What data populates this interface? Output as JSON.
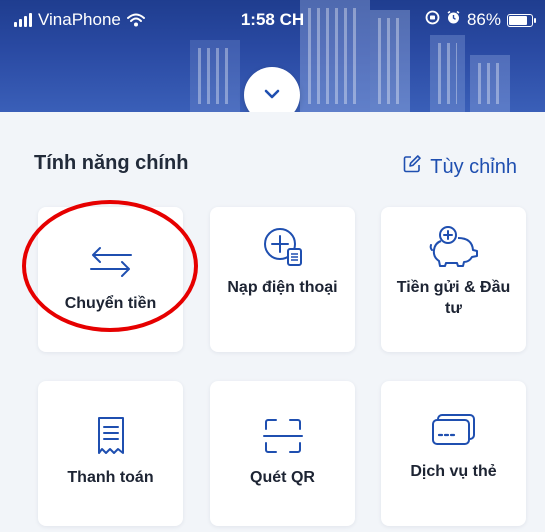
{
  "status_bar": {
    "carrier": "VinaPhone",
    "time": "1:58 CH",
    "battery": "86%",
    "battery_level": 0.86
  },
  "header": {
    "expand_icon": "chevron-down-icon"
  },
  "main_features": {
    "title": "Tính năng chính",
    "customize_label": "Tùy chỉnh",
    "customize_icon": "edit-icon"
  },
  "tiles": [
    {
      "label": "Chuyển tiền",
      "icon": "transfer-arrows-icon"
    },
    {
      "label": "Nạp điện thoại",
      "icon": "phone-topup-icon"
    },
    {
      "label": "Tiền gửi & Đầu tư",
      "icon": "piggy-bank-icon"
    },
    {
      "label": "Thanh toán",
      "icon": "receipt-icon"
    },
    {
      "label": "Quét QR",
      "icon": "qr-scan-icon"
    },
    {
      "label": "Dịch vụ thẻ",
      "icon": "card-icon"
    }
  ],
  "colors": {
    "primary": "#1f4fb0",
    "header": "#2a4aa3",
    "highlight": "#e60000"
  }
}
